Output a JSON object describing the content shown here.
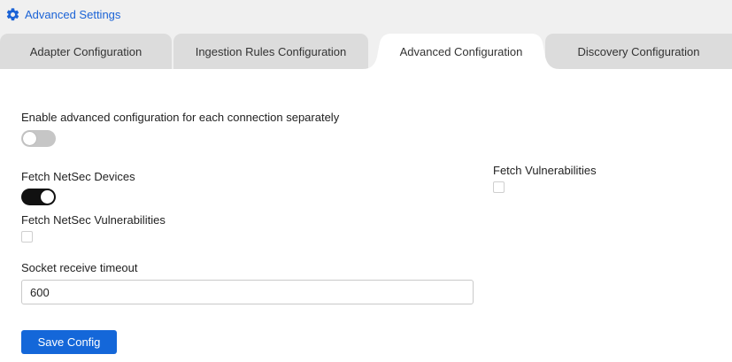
{
  "header": {
    "title": "Advanced Settings",
    "icon": "gear-icon",
    "accent_color": "#1b63d6"
  },
  "tabs": [
    {
      "label": "Adapter Configuration",
      "active": false
    },
    {
      "label": "Ingestion Rules Configuration",
      "active": false
    },
    {
      "label": "Advanced Configuration",
      "active": true
    },
    {
      "label": "Discovery Configuration",
      "active": false
    }
  ],
  "form": {
    "enable_per_connection": {
      "label": "Enable advanced configuration for each connection separately",
      "checked": false
    },
    "fetch_netsec_devices": {
      "label": "Fetch NetSec Devices",
      "checked": true
    },
    "fetch_netsec_vulnerabilities": {
      "label": "Fetch NetSec Vulnerabilities",
      "checked": false
    },
    "fetch_vulnerabilities": {
      "label": "Fetch Vulnerabilities",
      "checked": false
    },
    "socket_timeout": {
      "label": "Socket receive timeout",
      "value": "600"
    },
    "save_label": "Save Config"
  }
}
